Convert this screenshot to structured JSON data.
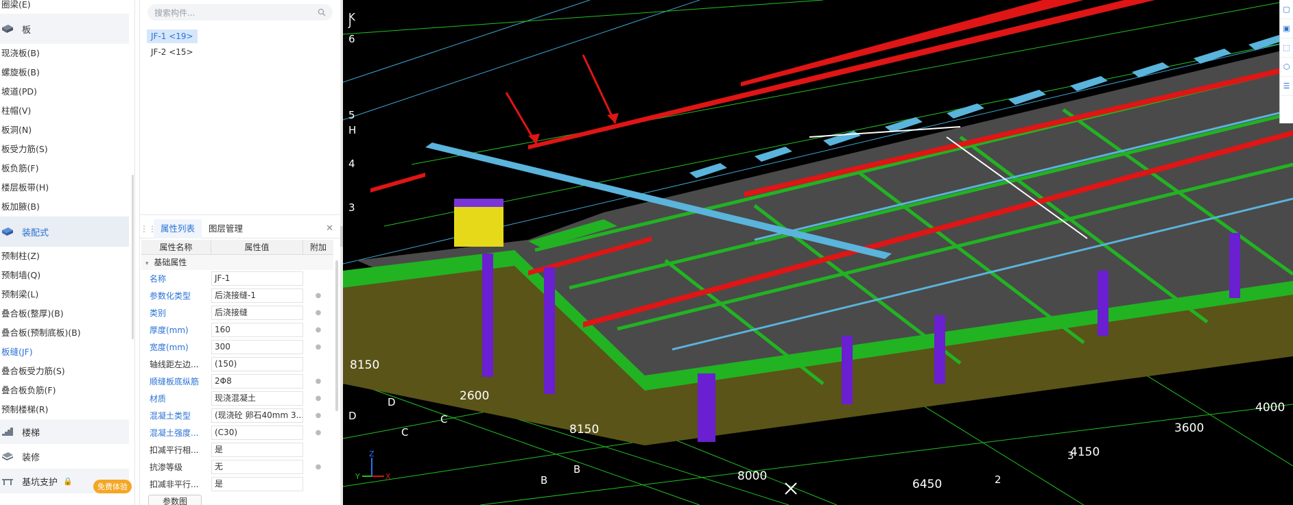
{
  "nav": {
    "top_item": "圈梁(E)",
    "group_slab": "板",
    "slab_items": [
      "现浇板(B)",
      "螺旋板(B)",
      "坡道(PD)",
      "柱帽(V)",
      "板洞(N)",
      "板受力筋(S)",
      "板负筋(F)",
      "楼层板带(H)",
      "板加腋(B)"
    ],
    "group_prefab": "装配式",
    "prefab_items": [
      "预制柱(Z)",
      "预制墙(Q)",
      "预制梁(L)",
      "叠合板(整厚)(B)",
      "叠合板(预制底板)(B)",
      "板缝(JF)",
      "叠合板受力筋(S)",
      "叠合板负筋(F)",
      "预制楼梯(R)"
    ],
    "group_stair": "楼梯",
    "group_decor": "装修",
    "group_pit": "基坑支护",
    "badge": "免费体验"
  },
  "components": {
    "search_placeholder": "搜索构件...",
    "items": [
      "JF-1 <19>",
      "JF-2 <15>"
    ]
  },
  "props": {
    "tab_active": "属性列表",
    "tab_other": "图层管理",
    "close": "✕",
    "col_name": "属性名称",
    "col_value": "属性值",
    "col_extra": "附加",
    "section": "基础属性",
    "rows": [
      {
        "k": "名称",
        "v": "JF-1",
        "blue": true
      },
      {
        "k": "参数化类型",
        "v": "后浇接缝-1",
        "blue": true
      },
      {
        "k": "类别",
        "v": "后浇接缝",
        "blue": true
      },
      {
        "k": "厚度(mm)",
        "v": "160",
        "blue": true
      },
      {
        "k": "宽度(mm)",
        "v": "300",
        "blue": true
      },
      {
        "k": "轴线距左边...",
        "v": "(150)",
        "blue": false
      },
      {
        "k": "顺缝板底纵筋",
        "v": "2Φ8",
        "blue": true
      },
      {
        "k": "材质",
        "v": "现浇混凝土",
        "blue": true
      },
      {
        "k": "混凝土类型",
        "v": "(现浇砼 卵石40mm 3...",
        "blue": true
      },
      {
        "k": "混凝土强度...",
        "v": "(C30)",
        "blue": true
      },
      {
        "k": "扣减平行相...",
        "v": "是",
        "blue": false
      },
      {
        "k": "抗渗等级",
        "v": "无",
        "blue": false
      },
      {
        "k": "扣减非平行...",
        "v": "是",
        "blue": false
      }
    ],
    "button": "参数图"
  },
  "viewport": {
    "axis_labels_left": [
      "K",
      "J",
      "6",
      "5",
      "H",
      "4",
      "3"
    ],
    "dims_front": [
      "8150",
      "2600",
      "8150",
      "8000",
      "6450",
      "4150",
      "3600",
      "4000"
    ],
    "axis_bubbles_front": [
      "D",
      "C",
      "D",
      "C",
      "B",
      "B",
      "2",
      "3"
    ],
    "gizmo": {
      "x": "X",
      "y": "Y",
      "z": "Z"
    },
    "colors": {
      "background": "#000000",
      "grid": "#22c322",
      "beam_red": "#e01515",
      "seam_blue": "#5ab4dc",
      "column_purple": "#6a1fd0",
      "slab_top": "#4a4a4a",
      "slab_side": "#5a5418"
    }
  }
}
